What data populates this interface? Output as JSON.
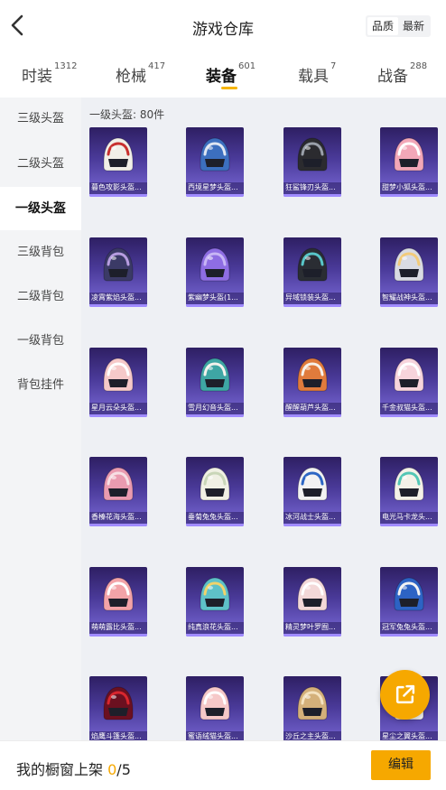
{
  "header": {
    "title": "游戏仓库",
    "sort_options": [
      "品质",
      "最新"
    ],
    "active_sort": 0
  },
  "tabs": [
    {
      "label": "时装",
      "count": "1312"
    },
    {
      "label": "枪械",
      "count": "417"
    },
    {
      "label": "装备",
      "count": "601"
    },
    {
      "label": "载具",
      "count": "7"
    },
    {
      "label": "战备",
      "count": "288"
    }
  ],
  "active_tab": 2,
  "sidebar": [
    {
      "label": "三级头盔"
    },
    {
      "label": "二级头盔"
    },
    {
      "label": "一级头盔"
    },
    {
      "label": "三级背包"
    },
    {
      "label": "二级背包"
    },
    {
      "label": "一级背包"
    },
    {
      "label": "背包挂件"
    }
  ],
  "active_sidebar": 2,
  "section": {
    "title": "一级头盔: 80件"
  },
  "items": [
    {
      "name": "暮色攻影头盔...",
      "colors": [
        "#f1efe8",
        "#c8302e"
      ]
    },
    {
      "name": "西境星梦头盔...",
      "colors": [
        "#3c6fbf",
        "#dfe6f2"
      ]
    },
    {
      "name": "狂鲨锋刃头盔...",
      "colors": [
        "#2b2b2f",
        "#9aa0aa"
      ]
    },
    {
      "name": "甜梦小狐头盔...",
      "colors": [
        "#f2a7b8",
        "#ffffff"
      ]
    },
    {
      "name": "凌霄紫焰头盔...",
      "colors": [
        "#3b3a66",
        "#b79de0"
      ]
    },
    {
      "name": "紫幽梦头盔(1...",
      "colors": [
        "#8e6de3",
        "#c8b6f5"
      ]
    },
    {
      "name": "异域锁装头盔...",
      "colors": [
        "#2a2d33",
        "#58c6c9"
      ]
    },
    {
      "name": "智耀战神头盔...",
      "colors": [
        "#d9dbe3",
        "#f2cb7a"
      ]
    },
    {
      "name": "星月云朵头盔...",
      "colors": [
        "#f6c9c9",
        "#ffffff"
      ]
    },
    {
      "name": "雪月幻音头盔...",
      "colors": [
        "#3ea6a4",
        "#f4f2ec"
      ]
    },
    {
      "name": "醒醒葫芦头盔...",
      "colors": [
        "#e07b3c",
        "#f6f1e9"
      ]
    },
    {
      "name": "千金叔猫头盔...",
      "colors": [
        "#f7d4dc",
        "#ffffff"
      ]
    },
    {
      "name": "香榛花海头盔...",
      "colors": [
        "#ea9bb0",
        "#f7dfe4"
      ]
    },
    {
      "name": "垂菊兔兔头盔...",
      "colors": [
        "#f0f0e4",
        "#c9d6b8"
      ]
    },
    {
      "name": "冰河战士头盔...",
      "colors": [
        "#f2f2f2",
        "#2c66c4"
      ]
    },
    {
      "name": "电光马卡龙头...",
      "colors": [
        "#f4f1e8",
        "#53c6b5"
      ]
    },
    {
      "name": "萌萌露比头盔...",
      "colors": [
        "#f2a3a8",
        "#ffffff"
      ]
    },
    {
      "name": "纯真浪花头盔...",
      "colors": [
        "#5ec1c8",
        "#f1d36b"
      ]
    },
    {
      "name": "精灵梦叶罗囿...",
      "colors": [
        "#f3d8d8",
        "#ffffff"
      ]
    },
    {
      "name": "冠军兔兔头盔...",
      "colors": [
        "#2d63c4",
        "#f2f2f2"
      ]
    },
    {
      "name": "焰鹰斗篷头盔...",
      "colors": [
        "#6b1020",
        "#d8262e"
      ]
    },
    {
      "name": "蜜语绒猫头盔...",
      "colors": [
        "#f6c8c8",
        "#ffffff"
      ]
    },
    {
      "name": "沙丘之主头盔...",
      "colors": [
        "#d4b07a",
        "#f4e2c0"
      ]
    },
    {
      "name": "星尘之翼头盔...",
      "colors": [
        "#f0f0f0",
        "#4b6fd8"
      ]
    }
  ],
  "footer": {
    "shelf_label": "我的橱窗上架",
    "shelf_current": "0",
    "shelf_total": "/5",
    "edit_label": "编辑"
  }
}
